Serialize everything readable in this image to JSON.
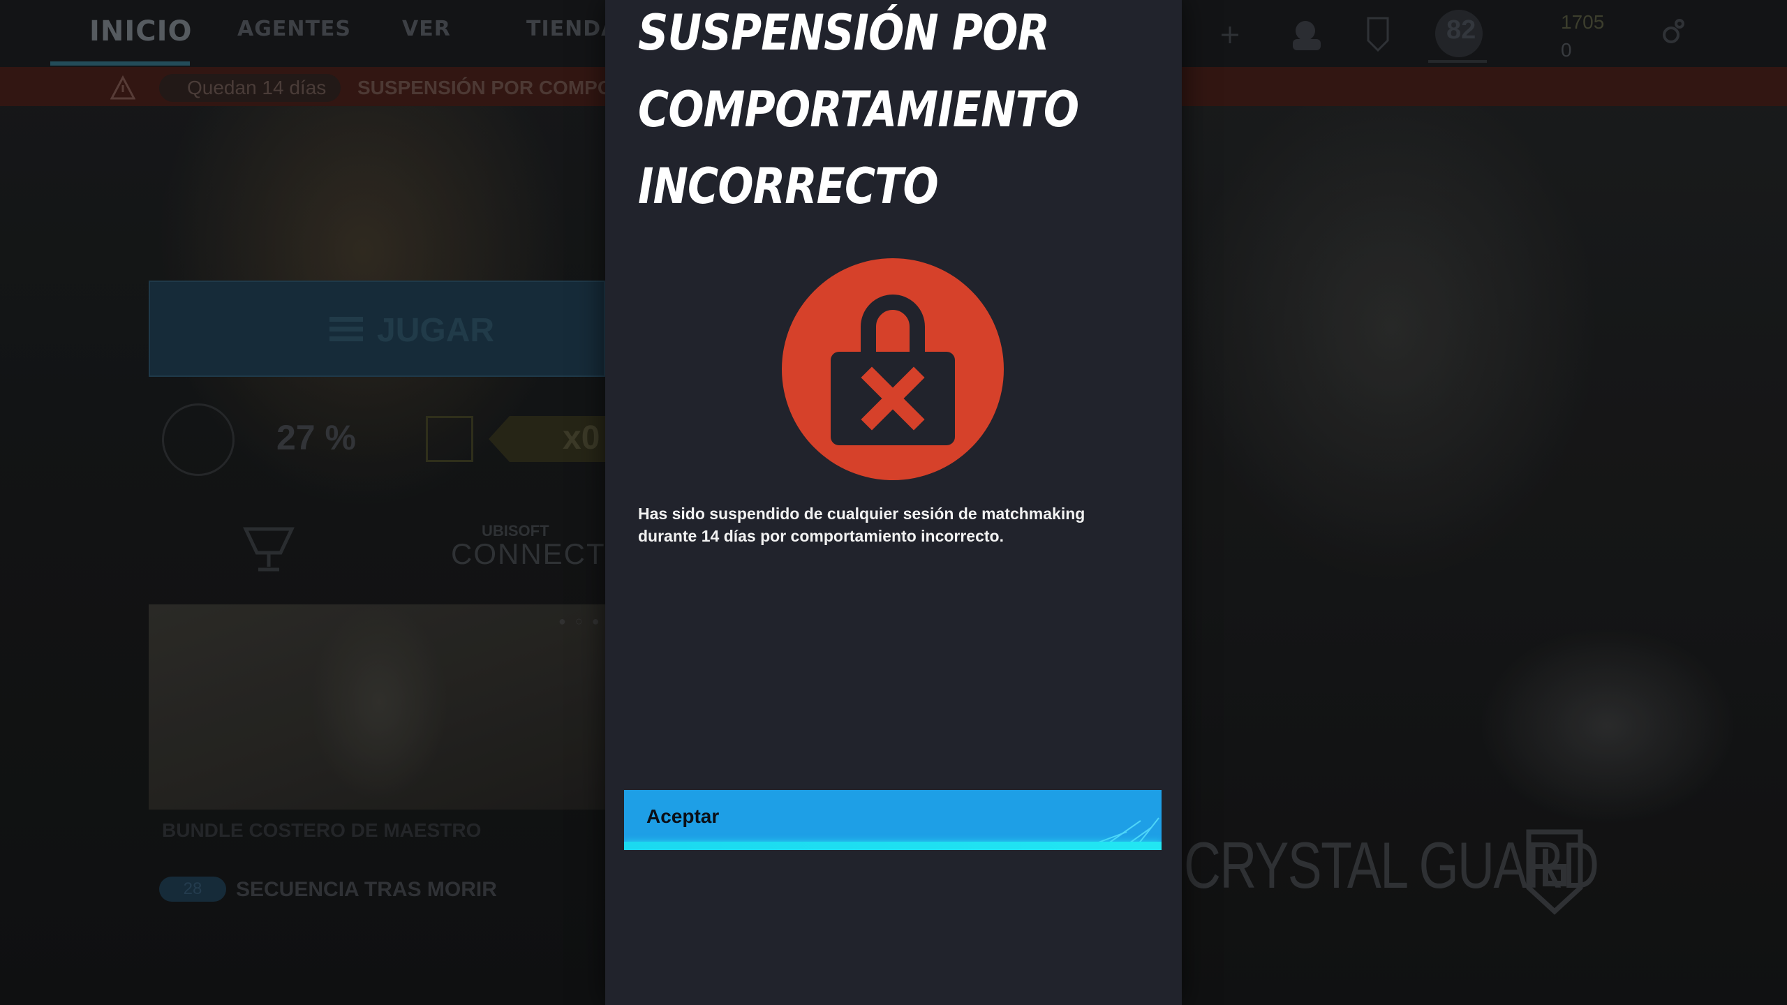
{
  "nav": {
    "tabs": [
      "INICIO",
      "AGENTES",
      "VER",
      "TIENDA"
    ],
    "active_tab": "INICIO",
    "level": "82",
    "credits": "1705",
    "renown": "0"
  },
  "alert": {
    "days_left": "Quedan 14 días",
    "text": "SUSPENSIÓN POR COMPORTAMIENTO INCORRECTO"
  },
  "home": {
    "play_label": "JUGAR",
    "progress_pct": "27 %",
    "pack_count": "x0",
    "ubisoft_small": "UBISOFT",
    "ubisoft_big": "CONNECT",
    "bundle_title": "BUNDLE COSTERO DE MAESTRO",
    "seq_badge": "28",
    "seq_text": "SECUENCIA TRAS MORIR",
    "crystal_guard": "CRYSTAL GUARD"
  },
  "modal": {
    "title": "SUSPENSIÓN POR COMPORTAMIENTO INCORRECTO",
    "body": "Has sido suspendido de cualquier sesión de matchmaking durante 14 días por comportamiento incorrecto.",
    "accept_label": "Aceptar",
    "icon": "lock-x-icon",
    "icon_color": "#d6412a",
    "button_color": "#1e9fe6"
  }
}
